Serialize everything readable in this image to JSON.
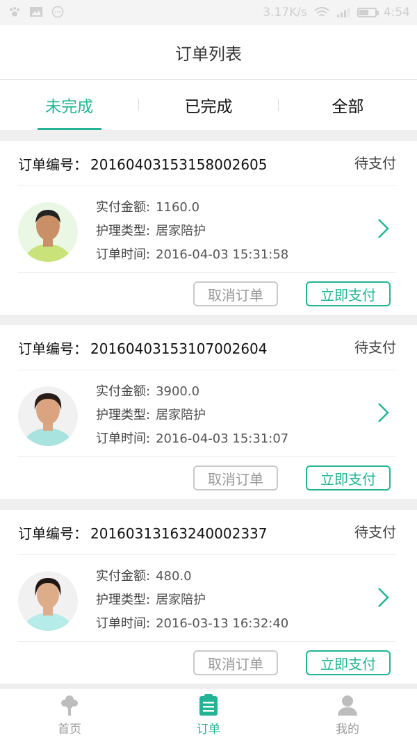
{
  "status_bar": {
    "net_speed": "3.17K/s",
    "time": "4:54",
    "left_icons": [
      "paw-icon",
      "image-icon",
      "circle-dots-icon"
    ],
    "right_icons": [
      "wifi-icon",
      "signal-icon",
      "battery-icon"
    ]
  },
  "header": {
    "title": "订单列表"
  },
  "tabs": [
    {
      "label": "未完成",
      "active": true
    },
    {
      "label": "已完成",
      "active": false
    },
    {
      "label": "全部",
      "active": false
    }
  ],
  "orders": [
    {
      "no_label": "订单编号：",
      "no": "20160403153158002605",
      "status": "待支付",
      "amount_label": "实付金额:",
      "amount": "1160.0",
      "type_label": "护理类型:",
      "type": "居家陪护",
      "time_label": "订单时间:",
      "time": "2016-04-03 15:31:58",
      "cancel_label": "取消订单",
      "pay_label": "立即支付"
    },
    {
      "no_label": "订单编号：",
      "no": "20160403153107002604",
      "status": "待支付",
      "amount_label": "实付金额:",
      "amount": "3900.0",
      "type_label": "护理类型:",
      "type": "居家陪护",
      "time_label": "订单时间:",
      "time": "2016-04-03 15:31:07",
      "cancel_label": "取消订单",
      "pay_label": "立即支付"
    },
    {
      "no_label": "订单编号：",
      "no": "20160313163240002337",
      "status": "待支付",
      "amount_label": "实付金额:",
      "amount": "480.0",
      "type_label": "护理类型:",
      "type": "居家陪护",
      "time_label": "订单时间:",
      "time": "2016-03-13 16:32:40",
      "cancel_label": "取消订单",
      "pay_label": "立即支付"
    }
  ],
  "bottom_nav": [
    {
      "label": "首页",
      "icon": "tree-icon",
      "active": false
    },
    {
      "label": "订单",
      "icon": "clipboard-icon",
      "active": true
    },
    {
      "label": "我的",
      "icon": "person-icon",
      "active": false
    }
  ],
  "colors": {
    "accent": "#22b495",
    "background": "#efefef"
  }
}
